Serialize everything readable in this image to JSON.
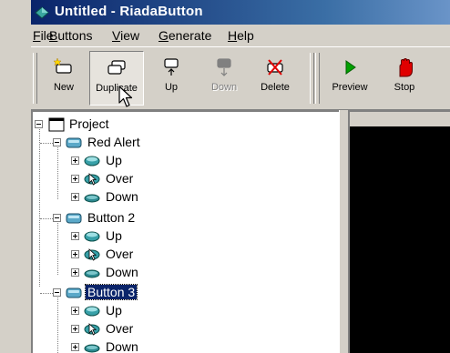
{
  "window": {
    "title": "Untitled - RiadaButton"
  },
  "menu": [
    {
      "label_prefix": "",
      "label_ul": "F",
      "label_rest": "ile"
    },
    {
      "label_prefix": "",
      "label_ul": "B",
      "label_rest": "uttons"
    },
    {
      "label_prefix": "",
      "label_ul": "V",
      "label_rest": "iew"
    },
    {
      "label_prefix": "",
      "label_ul": "G",
      "label_rest": "enerate"
    },
    {
      "label_prefix": "",
      "label_ul": "H",
      "label_rest": "elp"
    }
  ],
  "toolbar": {
    "new": "New",
    "duplicate": "Duplicate",
    "up": "Up",
    "down": "Down",
    "delete": "Delete",
    "preview": "Preview",
    "stop": "Stop"
  },
  "tree": {
    "root": "Project",
    "buttons": [
      {
        "name": "Red Alert",
        "states": [
          "Up",
          "Over",
          "Down"
        ],
        "selected": false
      },
      {
        "name": "Button 2",
        "states": [
          "Up",
          "Over",
          "Down"
        ],
        "selected": false
      },
      {
        "name": "Button 3",
        "states": [
          "Up",
          "Over",
          "Down"
        ],
        "selected": true
      }
    ]
  },
  "colors": {
    "title_active": "#0a246a",
    "selection": "#0a246a",
    "preview_bg": "#000000"
  }
}
